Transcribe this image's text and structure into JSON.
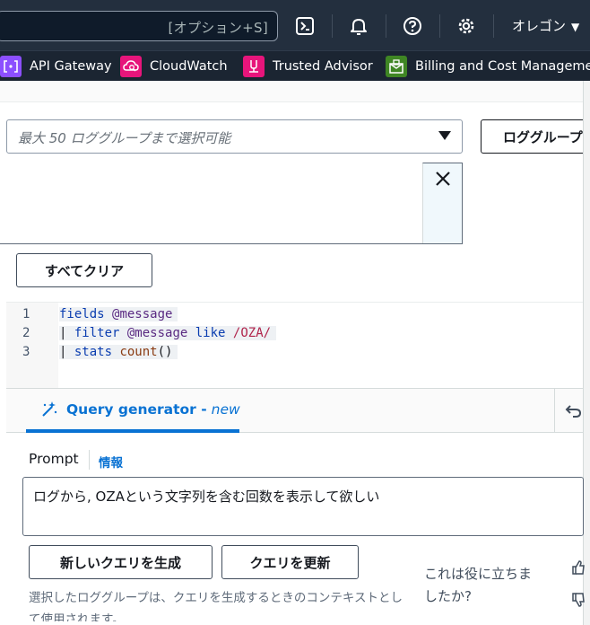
{
  "topbar": {
    "search_shortcut": "[オプション+S]",
    "region": "オレゴン"
  },
  "favorites": [
    {
      "label": "API Gateway",
      "color": "#8c4fff"
    },
    {
      "label": "CloudWatch",
      "color": "#e7157b"
    },
    {
      "label": "Trusted Advisor",
      "color": "#e7157b"
    },
    {
      "label": "Billing and Cost Management",
      "color": "#3f8624"
    }
  ],
  "log_groups": {
    "placeholder": "最大 50 ロググループまで選択可能",
    "browse_button": "ロググループを参照"
  },
  "clear_all_button": "すべてクリア",
  "editor": {
    "lines": [
      {
        "number": "1",
        "parts": [
          {
            "t": "fields",
            "c": "kw"
          },
          {
            "t": " ",
            "c": "pl"
          },
          {
            "t": "@message",
            "c": "at"
          }
        ]
      },
      {
        "number": "2",
        "parts": [
          {
            "t": "| ",
            "c": "pl"
          },
          {
            "t": "filter",
            "c": "kw"
          },
          {
            "t": " ",
            "c": "pl"
          },
          {
            "t": "@message",
            "c": "at"
          },
          {
            "t": " ",
            "c": "pl"
          },
          {
            "t": "like",
            "c": "kw"
          },
          {
            "t": " ",
            "c": "pl"
          },
          {
            "t": "/OZA/",
            "c": "rx"
          }
        ]
      },
      {
        "number": "3",
        "parts": [
          {
            "t": "| ",
            "c": "pl"
          },
          {
            "t": "stats",
            "c": "kw"
          },
          {
            "t": " ",
            "c": "pl"
          },
          {
            "t": "count",
            "c": "fn"
          },
          {
            "t": "()",
            "c": "pl"
          }
        ]
      }
    ]
  },
  "query_generator": {
    "tab_label": "Query generator -",
    "tab_badge": "new",
    "prompt_label": "Prompt",
    "info_link": "情報",
    "prompt_value": "ログから, OZAという文字列を含む回数を表示して欲しい",
    "generate_button": "新しいクエリを生成",
    "update_button": "クエリを更新",
    "feedback_line1": "これは役に立ちま",
    "feedback_line2": "したか?",
    "hint_text": "選択したロググループは、クエリを生成するときのコンテキストとして使用されます。"
  }
}
